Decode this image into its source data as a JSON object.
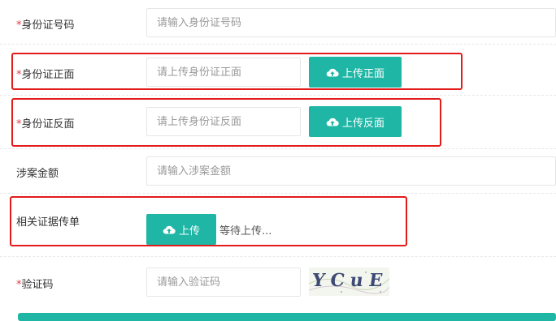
{
  "id_number": {
    "required_mark": "*",
    "label": "身份证号码",
    "placeholder": "请输入身份证号码"
  },
  "id_front": {
    "required_mark": "*",
    "label": "身份证正面",
    "placeholder": "请上传身份证正面",
    "button_label": "上传正面"
  },
  "id_back": {
    "required_mark": "*",
    "label": "身份证反面",
    "placeholder": "请上传身份证反面",
    "button_label": "上传反面"
  },
  "amount": {
    "label": "涉案金额",
    "placeholder": "请输入涉案金额"
  },
  "evidence": {
    "label": "相关证据传单",
    "button_label": "上传",
    "status": "等待上传..."
  },
  "captcha": {
    "required_mark": "*",
    "label": "验证码",
    "placeholder": "请输入验证码",
    "image_text": "YCuE"
  },
  "colors": {
    "accent": "#1fb6a5",
    "required": "#e0393e",
    "highlight": "#e31b1b"
  },
  "icons": {
    "upload_button_icon": "cloud-upload-icon"
  }
}
